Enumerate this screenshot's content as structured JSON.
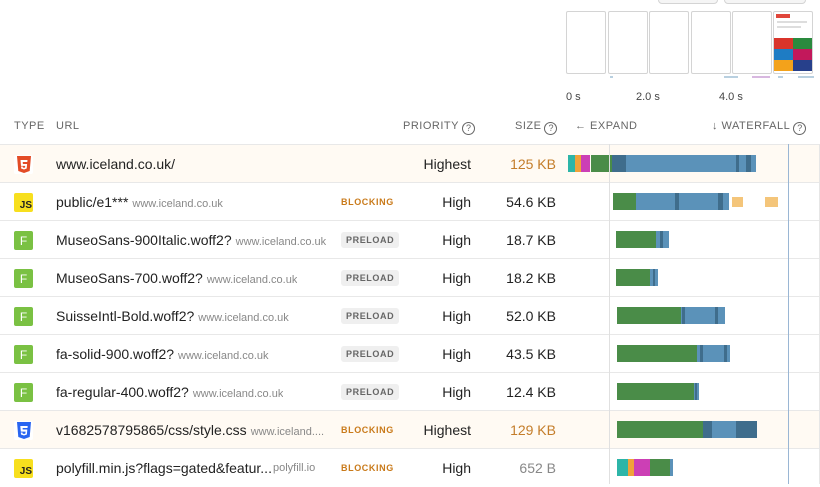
{
  "filmstrip": {
    "ticks": [
      "0 s",
      "2.0 s",
      "4.0 s"
    ]
  },
  "headers": {
    "type": "TYPE",
    "url": "URL",
    "priority": "PRIORITY",
    "size": "SIZE",
    "expand": "← EXPAND",
    "waterfall": "↓ WATERFALL",
    "help_glyph": "?"
  },
  "colors": {
    "dns": "#2db5a8",
    "connect": "#f0a23a",
    "ssl": "#cc3fb5",
    "ttfb": "#4a8c48",
    "download": "#5b92b9",
    "download_dark": "#3f6d8c",
    "idle": "#f4c57a"
  },
  "requests": [
    {
      "type": "html",
      "icon_label": "",
      "url": "www.iceland.co.uk/",
      "domain": "",
      "tag": "",
      "priority": "Highest",
      "size": "125 KB",
      "size_style": "orange"
    },
    {
      "type": "js",
      "icon_label": "JS",
      "url": "public/e1***",
      "domain": "www.iceland.co.uk",
      "tag": "BLOCKING",
      "priority": "High",
      "size": "54.6 KB",
      "size_style": "normal"
    },
    {
      "type": "font",
      "icon_label": "F",
      "url": "MuseoSans-900Italic.woff2?",
      "domain": "www.iceland.co.uk",
      "tag": "PRELOAD",
      "priority": "High",
      "size": "18.7 KB",
      "size_style": "normal"
    },
    {
      "type": "font",
      "icon_label": "F",
      "url": "MuseoSans-700.woff2?",
      "domain": "www.iceland.co.uk",
      "tag": "PRELOAD",
      "priority": "High",
      "size": "18.2 KB",
      "size_style": "normal"
    },
    {
      "type": "font",
      "icon_label": "F",
      "url": "SuisseIntl-Bold.woff2?",
      "domain": "www.iceland.co.uk",
      "tag": "PRELOAD",
      "priority": "High",
      "size": "52.0 KB",
      "size_style": "normal"
    },
    {
      "type": "font",
      "icon_label": "F",
      "url": "fa-solid-900.woff2?",
      "domain": "www.iceland.co.uk",
      "tag": "PRELOAD",
      "priority": "High",
      "size": "43.5 KB",
      "size_style": "normal"
    },
    {
      "type": "font",
      "icon_label": "F",
      "url": "fa-regular-400.woff2?",
      "domain": "www.iceland.co.uk",
      "tag": "PRELOAD",
      "priority": "High",
      "size": "12.4 KB",
      "size_style": "normal"
    },
    {
      "type": "css",
      "icon_label": "",
      "url": "v1682578795865/css/style.css",
      "domain": "www.iceland....",
      "tag": "BLOCKING",
      "priority": "Highest",
      "size": "129 KB",
      "size_style": "orange"
    },
    {
      "type": "js",
      "icon_label": "JS",
      "url": "polyfill.min.js?flags=gated&featur...",
      "domain": "polyfill.io",
      "tag": "BLOCKING",
      "priority": "High",
      "size": "652 B",
      "size_style": "gray"
    }
  ]
}
